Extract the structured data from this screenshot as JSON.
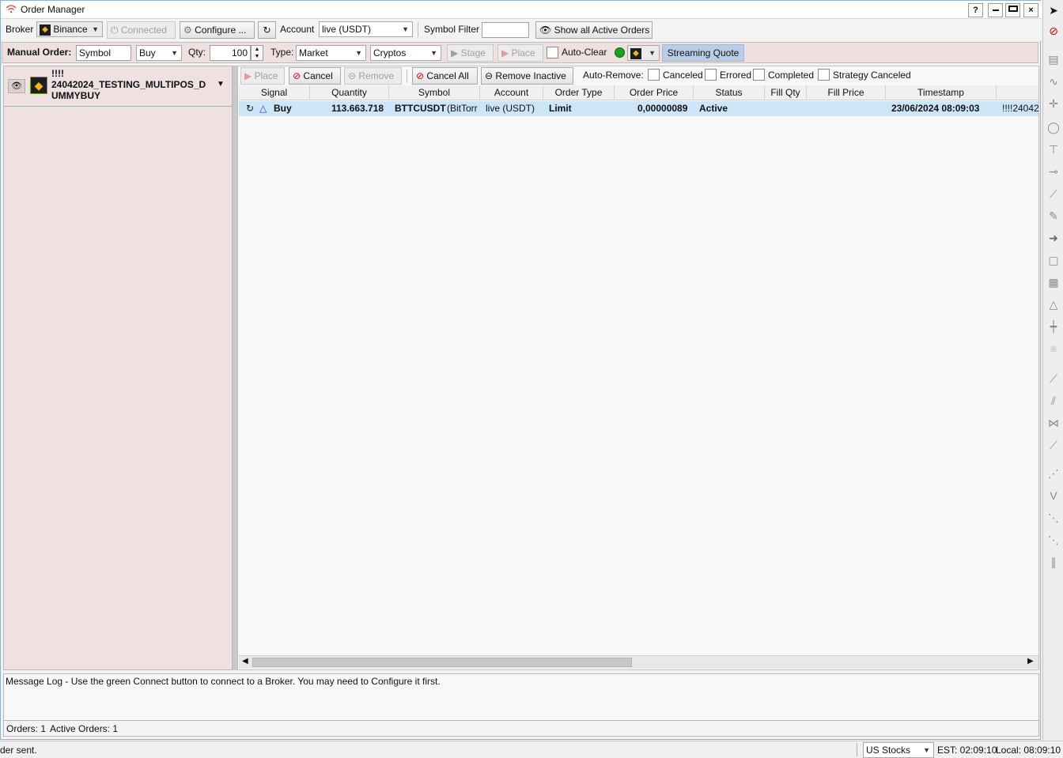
{
  "window": {
    "title": "Order Manager",
    "controls": {
      "help": "?",
      "minimize": "—",
      "maximize": "▭",
      "close": "×"
    }
  },
  "toolbar": {
    "broker_label": "Broker",
    "broker_value": "Binance",
    "connected_label": "Connected",
    "configure_label": "Configure ...",
    "account_label": "Account",
    "account_value": "live (USDT)",
    "symbol_filter_label": "Symbol Filter",
    "symbol_filter_value": "",
    "show_all_label": "Show all Active Orders"
  },
  "manual_order": {
    "label": "Manual Order:",
    "symbol_value": "Symbol",
    "side_value": "Buy",
    "qty_label": "Qty:",
    "qty_value": "100",
    "type_label": "Type:",
    "type_value": "Market",
    "asset_value": "Cryptos",
    "stage_label": "Stage",
    "place_label": "Place",
    "auto_clear_label": "Auto-Clear",
    "streaming_label": "Streaming Quote"
  },
  "strategy": {
    "line1": "!!!!",
    "line2": "24042024_TESTING_MULTIPOS_D",
    "line3": "UMMYBUY"
  },
  "order_actions": {
    "place": "Place",
    "cancel": "Cancel",
    "remove": "Remove",
    "cancel_all": "Cancel All",
    "remove_inactive": "Remove Inactive",
    "auto_remove_label": "Auto-Remove:",
    "canceled": "Canceled",
    "errored": "Errored",
    "completed": "Completed",
    "strategy_canceled": "Strategy Canceled"
  },
  "grid": {
    "columns": [
      "Signal",
      "Quantity",
      "Symbol",
      "Account",
      "Order Type",
      "Order Price",
      "Status",
      "Fill Qty",
      "Fill Price",
      "Timestamp"
    ],
    "rows": [
      {
        "signal": "Buy",
        "quantity": "113.663.718",
        "symbol": "BTTCUSDT",
        "symbol_desc": "(BitTorr",
        "account": "live (USDT)",
        "order_type": "Limit",
        "order_price": "0,00000089",
        "status": "Active",
        "fill_qty": "",
        "fill_price": "",
        "timestamp": "23/06/2024 08:09:03",
        "strategy": "!!!!24042("
      }
    ]
  },
  "message_log": "Message Log - Use the green Connect button to connect to a Broker. You may need to Configure it first.",
  "counts": {
    "orders_text": "Orders: 1",
    "active_text": "Active Orders: 1"
  },
  "statusbar": {
    "left_text": "der sent.",
    "market_value": "US Stocks",
    "est_text": "EST: 02:09:10",
    "local_text": "Local: 08:09:10"
  },
  "colors": {
    "manual_bar": "#efe0e0",
    "selected_row": "#cde6f7",
    "streaming_btn": "#b9cde6",
    "brand": "#f0b90b"
  }
}
